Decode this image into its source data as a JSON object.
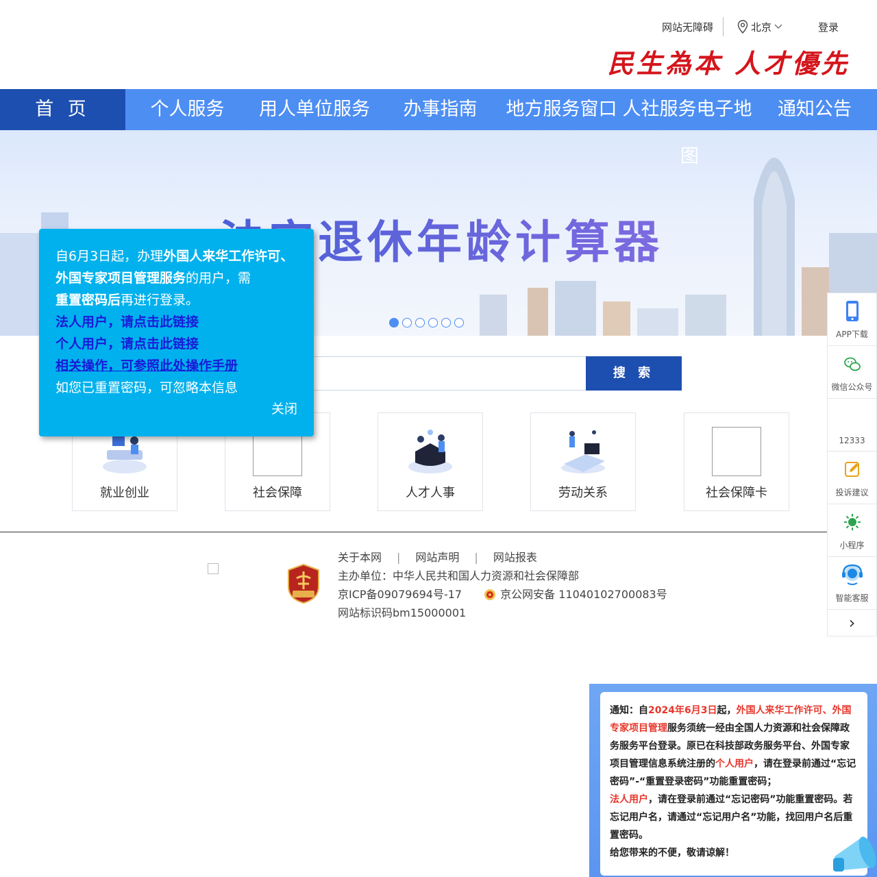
{
  "header": {
    "accessibility": "网站无障碍",
    "location": "北京",
    "login": "登录",
    "slogan": "民生為本  人才優先"
  },
  "nav": {
    "items": [
      "首 页",
      "个人服务",
      "用人单位服务",
      "办事指南",
      "地方服务窗口",
      "人社服务电子地",
      "通知公告"
    ],
    "overflow_char": "图"
  },
  "banner": {
    "title": "法定退休年龄计算器",
    "dots_total": 6,
    "active_dot": 0
  },
  "search": {
    "placeholder": "",
    "button": "搜 索"
  },
  "tiles": [
    {
      "label": "就业创业"
    },
    {
      "label": "社会保障"
    },
    {
      "label": "人才人事"
    },
    {
      "label": "劳动关系"
    },
    {
      "label": "社会保障卡"
    }
  ],
  "footer": {
    "links": [
      "关于本网",
      "网站声明",
      "网站报表"
    ],
    "sponsor": "主办单位：中华人民共和国人力资源和社会保障部",
    "icp": "京ICP备09079694号-17",
    "police": "京公网安备 11040102700083号",
    "site_code": "网站标识码bm15000001",
    "badge_text": "党政机关"
  },
  "sidebar": {
    "items": [
      {
        "label": "APP下载",
        "icon": "phone-icon"
      },
      {
        "label": "微信公众号",
        "icon": "wechat-icon"
      },
      {
        "label": "12333",
        "icon": "hotline-icon"
      },
      {
        "label": "投诉建议",
        "icon": "edit-icon"
      },
      {
        "label": "小程序",
        "icon": "miniprogram-icon"
      },
      {
        "label": "智能客服",
        "icon": "customer-service-icon"
      }
    ],
    "arrow": "›"
  },
  "popup": {
    "line1_pre": "自6月3日起，办理",
    "line1_bold": "外国人来华工作许可、外国专家项目管理服务",
    "line1_post": "的用户，需",
    "line2_bold": "重置密码后",
    "line2_post": "再进行登录。",
    "link_corp": "法人用户，请点击此链接",
    "link_person": "个人用户，请点击此链接",
    "link_manual": "相关操作，可参照此处操作手册",
    "ignore": "如您已重置密码，可忽略本信息",
    "close": "关闭"
  },
  "notice": {
    "p1": "通知：自",
    "p1_red1": "2024年6月3日",
    "p1_mid": "起，",
    "p1_red2": "外国人来华工作许可、外国专家项目管理",
    "p1_post": "服务须统一经由全国人力资源和社会保障政务服务平台登录。原已在科技部政务服务平台、外国专家项目管理信息系统注册的",
    "p1_red3": "个人用户",
    "p1_post2": "，请在登录前通过“忘记密码”-“重置登录密码”功能重置密码；",
    "p2_red": "法人用户",
    "p2_post": "，请在登录前通过“忘记密码”功能重置密码。若忘记用户名，请通过“忘记用户名”功能，找回用户名后重置密码。",
    "p3": "给您带来的不便，敬请谅解！"
  },
  "colors": {
    "nav": "#4d8ef2",
    "nav_active": "#1d4fb0",
    "popup": "#00b1ed",
    "slogan": "#d5151c"
  }
}
